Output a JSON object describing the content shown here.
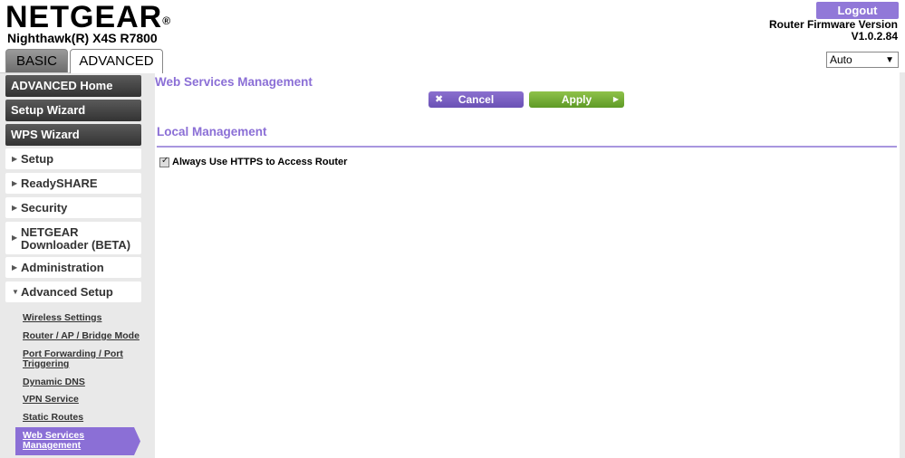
{
  "header": {
    "brand": "NETGEAR",
    "brand_mark": "®",
    "model": "Nighthawk(R) X4S R7800",
    "logout_label": "Logout",
    "firmware_label": "Router Firmware Version",
    "firmware_version": "V1.0.2.84",
    "tabs": [
      {
        "label": "BASIC",
        "active": false
      },
      {
        "label": "ADVANCED",
        "active": true
      }
    ],
    "language_select": "Auto"
  },
  "sidebar": {
    "main_buttons": [
      {
        "label": "ADVANCED Home"
      },
      {
        "label": "Setup Wizard"
      },
      {
        "label": "WPS Wizard"
      }
    ],
    "sections": [
      {
        "label": "Setup",
        "expanded": false
      },
      {
        "label": "ReadySHARE",
        "expanded": false
      },
      {
        "label": "Security",
        "expanded": false
      },
      {
        "label": "NETGEAR Downloader (BETA)",
        "line1": "NETGEAR",
        "line2": "Downloader (BETA)",
        "expanded": false
      },
      {
        "label": "Administration",
        "expanded": false
      },
      {
        "label": "Advanced Setup",
        "expanded": true
      }
    ],
    "sub_items": [
      {
        "label": "Wireless Settings"
      },
      {
        "label": "Router / AP / Bridge Mode"
      },
      {
        "label": "Port Forwarding / Port Triggering",
        "line1": "Port Forwarding / Port",
        "line2": "Triggering"
      },
      {
        "label": "Dynamic DNS"
      },
      {
        "label": "VPN Service"
      },
      {
        "label": "Static Routes"
      },
      {
        "label": "Web Services Management",
        "line1": "Web Services",
        "line2": "Management",
        "active": true
      }
    ]
  },
  "main": {
    "page_title": "Web Services Management",
    "cancel_label": "Cancel",
    "apply_label": "Apply",
    "section_title": "Local Management",
    "https_checkbox_label": "Always Use HTTPS to Access Router",
    "https_checked": true
  },
  "colors": {
    "accent": "#8b6fd6",
    "apply": "#6fa832",
    "sidebar_bg": "#e9e9e9"
  }
}
